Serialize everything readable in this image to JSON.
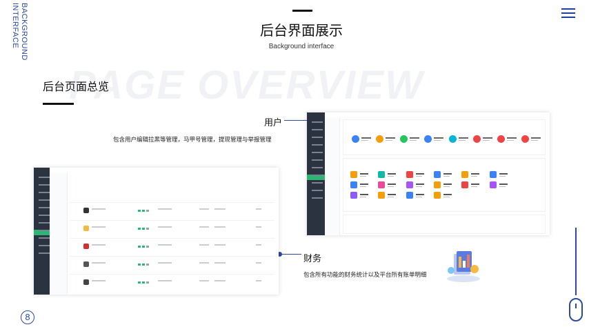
{
  "header": {
    "vertical_label_line1": "BACKGROUND",
    "vertical_label_line2": "INTERFACE",
    "title": "后台界面展示",
    "subtitle": "Background interface"
  },
  "section": {
    "watermark": "PAGE OVERVIEW",
    "title": "后台页面总览"
  },
  "callouts": {
    "user": {
      "label": "用户",
      "description": "包含用户编辑拉黑等管理，马甲号管理，提现管理与举报管理"
    },
    "finance": {
      "label": "财务",
      "description": "包含所有功能的财务统计以及平台所有账单明细"
    }
  },
  "footer": {
    "page_number": "8"
  },
  "icons": {
    "menu": "hamburger-menu-icon",
    "scroll": "mouse-scroll-icon"
  },
  "colors": {
    "accent": "#2a4aa0",
    "sidebar": "#2b3340",
    "active": "#2bb673",
    "stat_circles": [
      "#3b82f6",
      "#f59e0b",
      "#22c55e",
      "#3b82f6",
      "#06b6d4",
      "#ef4444",
      "#ef4444",
      "#ef4444"
    ],
    "tiles": [
      "#f59e0b",
      "#14b8a6",
      "#ef4444",
      "#3b82f6",
      "#f59e0b",
      "#3b82f6",
      "#3b82f6",
      "#ec4899",
      "#a855f7",
      "#f59e0b",
      "#ef4444",
      "#a855f7",
      "#8b5cf6",
      "#f59e0b",
      "#3b82f6",
      "#f59e0b"
    ]
  }
}
